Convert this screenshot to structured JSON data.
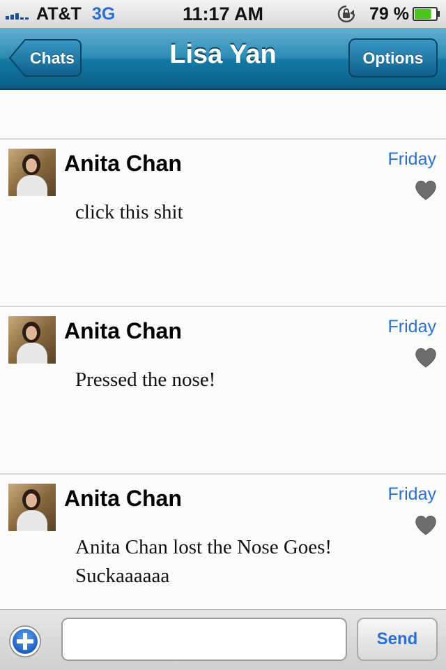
{
  "status_bar": {
    "carrier": "AT&T",
    "network": "3G",
    "time": "11:17 AM",
    "battery": "79 %",
    "battery_level": 0.79,
    "icons": [
      "signal-icon",
      "rotation-lock-icon",
      "battery-icon"
    ]
  },
  "nav_bar": {
    "back_label": "Chats",
    "title": "Lisa Yan",
    "options_label": "Options"
  },
  "messages": [
    {
      "sender": "Anita Chan",
      "time": "Friday",
      "text": "click this shit"
    },
    {
      "sender": "Anita Chan",
      "time": "Friday",
      "text": "Pressed the nose!"
    },
    {
      "sender": "Anita Chan",
      "time": "Friday",
      "text": "Anita Chan lost the Nose Goes! Suckaaaaaa"
    }
  ],
  "composer": {
    "input_value": "",
    "placeholder": "",
    "send_label": "Send",
    "add_icon": "plus-circle-icon"
  },
  "colors": {
    "nav_blue": "#137aa6",
    "link_blue": "#2a6fd6",
    "heart_gray": "#6e6e6e"
  }
}
